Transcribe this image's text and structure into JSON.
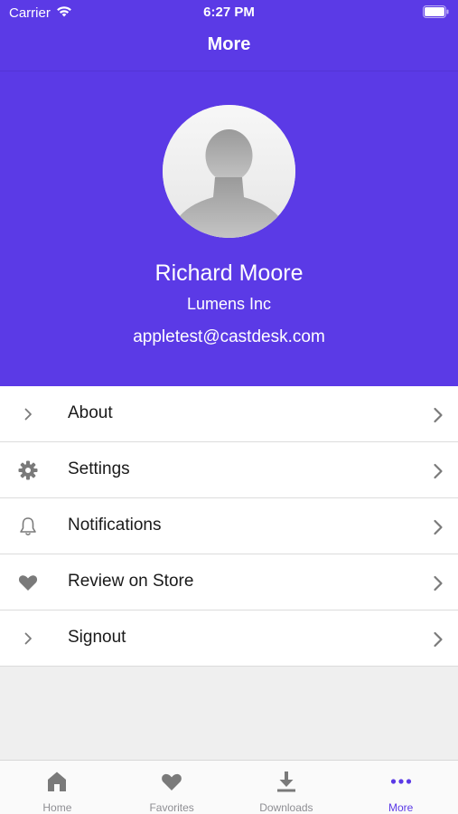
{
  "status_bar": {
    "carrier": "Carrier",
    "time": "6:27 PM"
  },
  "nav": {
    "title": "More"
  },
  "profile": {
    "name": "Richard Moore",
    "company": "Lumens Inc",
    "email": "appletest@castdesk.com"
  },
  "menu": [
    {
      "label": "About",
      "icon": "chevron-right-icon"
    },
    {
      "label": "Settings",
      "icon": "gear-icon"
    },
    {
      "label": "Notifications",
      "icon": "bell-icon"
    },
    {
      "label": "Review on Store",
      "icon": "heart-icon"
    },
    {
      "label": "Signout",
      "icon": "chevron-right-icon"
    }
  ],
  "tabs": [
    {
      "label": "Home",
      "icon": "home-icon",
      "active": false
    },
    {
      "label": "Favorites",
      "icon": "heart-icon",
      "active": false
    },
    {
      "label": "Downloads",
      "icon": "download-icon",
      "active": false
    },
    {
      "label": "More",
      "icon": "more-dots-icon",
      "active": true
    }
  ],
  "colors": {
    "accent": "#5b3ae6",
    "icon_gray": "#7a7a7a",
    "inactive_tab": "#8e8e93"
  }
}
